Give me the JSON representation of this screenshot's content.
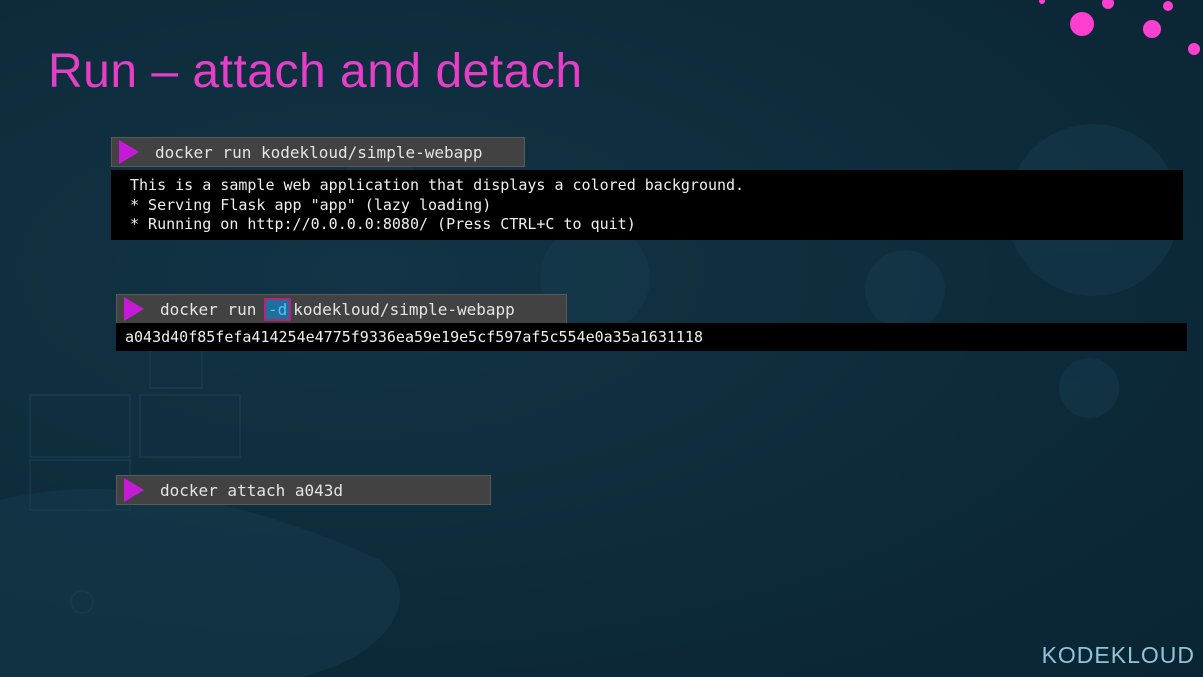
{
  "slide": {
    "title": "Run – attach and detach",
    "brand": {
      "logo_text": "KODEKLOUD"
    }
  },
  "colors": {
    "title": "#e63fc7",
    "play_marker": "#c61bd6",
    "command_bar": "#424242",
    "output_bg": "#000000",
    "flag_highlight": "#1f6f9c",
    "flag_border": "#b2247f",
    "decor_dots": "#ff3fd0"
  },
  "commands": [
    {
      "icon": "play-icon",
      "text": "docker run kodekloud/simple-webapp",
      "output": [
        "This is a sample web application that displays a colored background.",
        "* Serving Flask app \"app\" (lazy loading)",
        "* Running on http://0.0.0.0:8080/ (Press CTRL+C to quit)"
      ]
    },
    {
      "icon": "play-icon",
      "prefix": "docker run ",
      "flag": "-d",
      "suffix": "kodekloud/simple-webapp",
      "output": [
        "a043d40f85fefa414254e4775f9336ea59e19e5cf597af5c554e0a35a1631118"
      ]
    },
    {
      "icon": "play-icon",
      "text": "docker attach a043d"
    }
  ]
}
